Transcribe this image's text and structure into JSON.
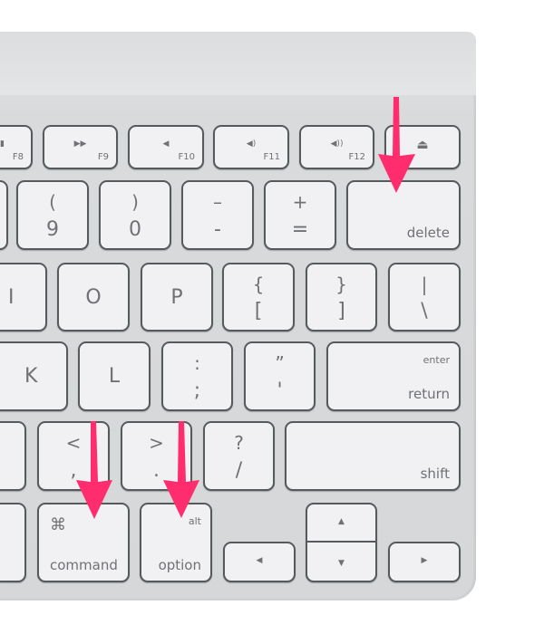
{
  "keyboard": {
    "function_row": [
      {
        "icon": "play-pause-icon",
        "glyph": "▮",
        "label": "F8"
      },
      {
        "icon": "fast-forward-icon",
        "glyph": "▶▶",
        "label": "F9"
      },
      {
        "icon": "mute-icon",
        "glyph": "◀",
        "label": "F10"
      },
      {
        "icon": "volume-down-icon",
        "glyph": "◀)",
        "label": "F11"
      },
      {
        "icon": "volume-up-icon",
        "glyph": "◀))",
        "label": "F12"
      },
      {
        "icon": "eject-icon",
        "glyph": "⏏",
        "label": ""
      }
    ],
    "number_row": [
      {
        "top": "(",
        "bottom": "9"
      },
      {
        "top": ")",
        "bottom": "0"
      },
      {
        "top": "–",
        "bottom": "-"
      },
      {
        "top": "+",
        "bottom": "="
      },
      {
        "label": "delete"
      }
    ],
    "top_row": [
      {
        "label": "I"
      },
      {
        "label": "O"
      },
      {
        "label": "P"
      },
      {
        "top": "{",
        "bottom": "["
      },
      {
        "top": "}",
        "bottom": "]"
      },
      {
        "top": "|",
        "bottom": "\\"
      }
    ],
    "home_row": [
      {
        "label": "K"
      },
      {
        "label": "L"
      },
      {
        "top": ":",
        "bottom": ";"
      },
      {
        "top": "”",
        "bottom": "'"
      },
      {
        "top": "enter",
        "bottom": "return"
      }
    ],
    "bottom_row": [
      {
        "top": "<",
        "bottom": ","
      },
      {
        "top": ">",
        "bottom": "."
      },
      {
        "top": "?",
        "bottom": "/"
      },
      {
        "label": "shift"
      }
    ],
    "modifier_row": [
      {
        "symbol": "⌘",
        "label": "command"
      },
      {
        "top": "alt",
        "label": "option"
      },
      {
        "icon": "arrow-left-icon",
        "glyph": "◀"
      },
      {
        "icon": "arrow-up-icon",
        "glyph": "▲"
      },
      {
        "icon": "arrow-down-icon",
        "glyph": "▼"
      },
      {
        "icon": "arrow-right-icon",
        "glyph": "▶"
      }
    ]
  },
  "annotations": {
    "arrow_color": "#ff2d6e",
    "targets": [
      "delete",
      "command",
      "option"
    ]
  }
}
